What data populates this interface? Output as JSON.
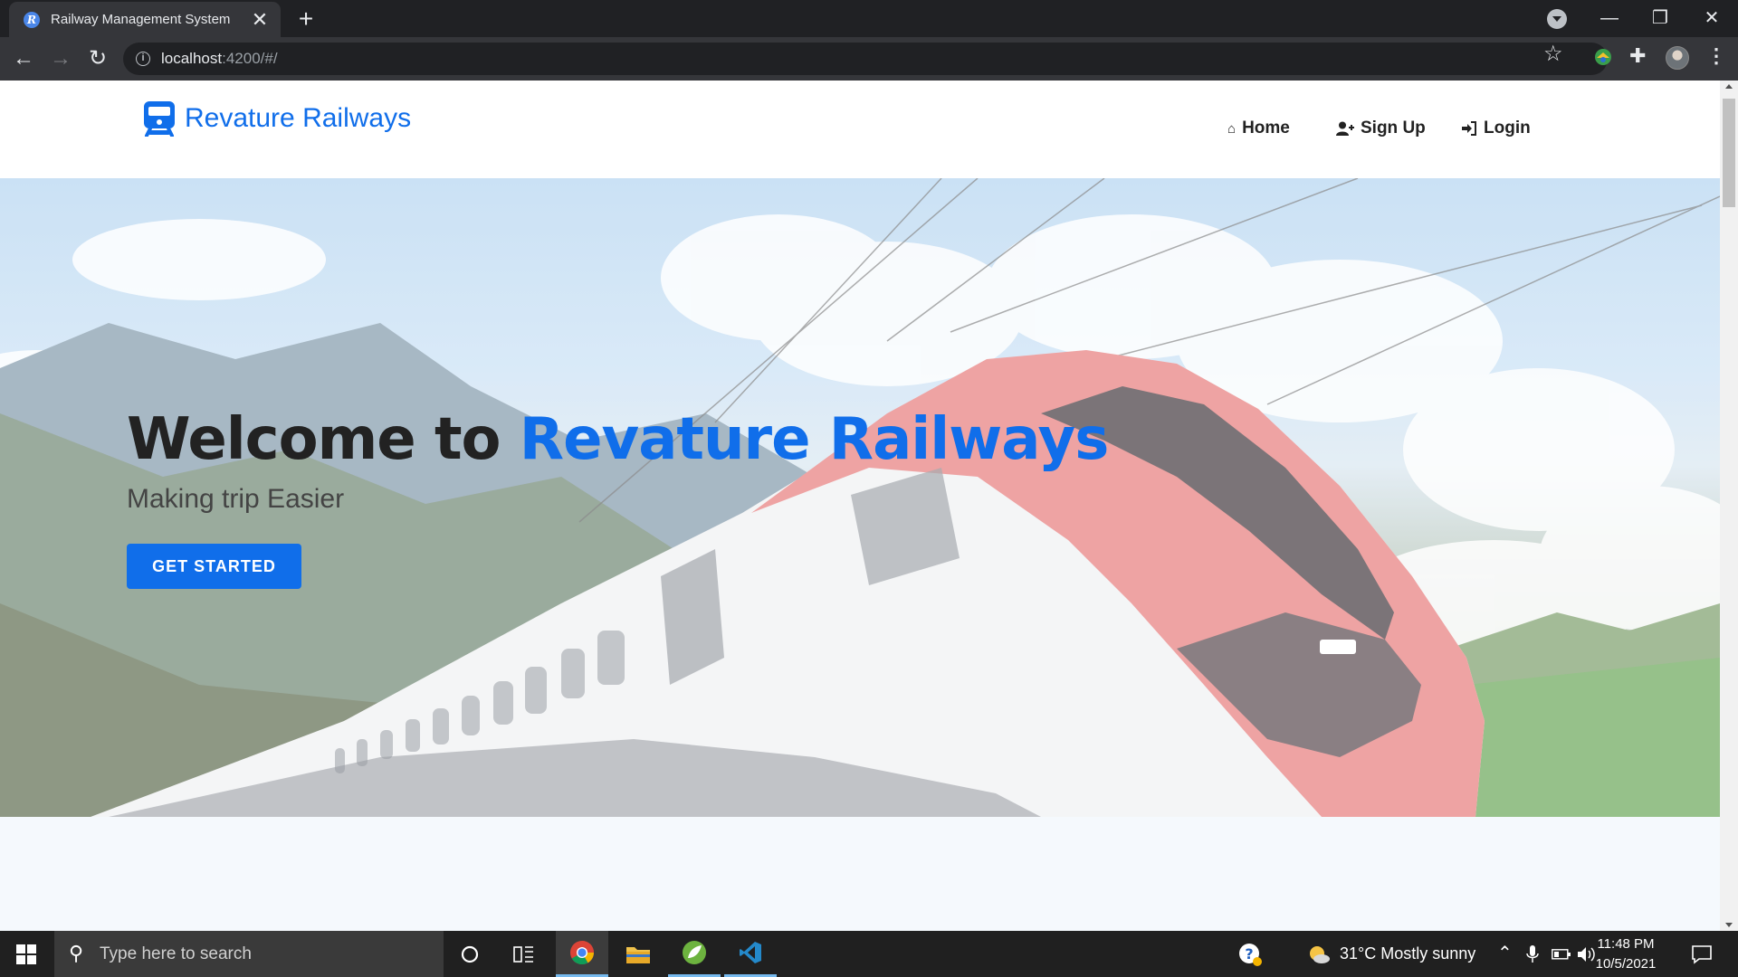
{
  "browser": {
    "tab_title": "Railway Management System",
    "tab_close": "✕",
    "new_tab": "+",
    "url_host": "localhost",
    "url_path": ":4200/#/",
    "window_controls": [
      "—",
      "❐",
      "✕"
    ]
  },
  "site": {
    "brand": "Revature Railways",
    "nav": [
      {
        "label": "Home",
        "icon": "home-icon"
      },
      {
        "label": "Sign Up",
        "icon": "user-plus-icon"
      },
      {
        "label": "Login",
        "icon": "sign-in-icon"
      }
    ]
  },
  "hero": {
    "title_prefix": "Welcome to ",
    "title_accent": "Revature Railways",
    "subtitle": "Making trip Easier",
    "cta_label": "GET STARTED"
  },
  "taskbar": {
    "search_placeholder": "Type here to search",
    "weather": "31°C  Mostly sunny",
    "time": "11:48 PM",
    "date": "10/5/2021"
  },
  "colors": {
    "accent": "#106eea",
    "chrome_dark": "#202124",
    "chrome_toolbar": "#35363a",
    "taskbar": "#202020"
  }
}
